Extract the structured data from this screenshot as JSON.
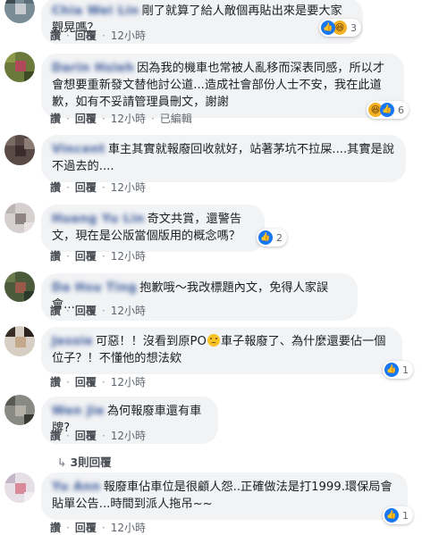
{
  "actions": {
    "like": "讚",
    "reply": "回覆",
    "sep": "·",
    "edited": "已編輯"
  },
  "replies_link": "3則回覆",
  "comments": [
    {
      "name": "Chia Wei Lin",
      "text": "剛了就算了給人敵個再貼出來是要大家觀晃嗎？",
      "time": "12小時",
      "reactions": "3",
      "react_types": [
        "like",
        "haha"
      ]
    },
    {
      "name": "Darin Hsieh",
      "text": "因為我的機車也常被人亂移而深表同感，所以才會想要重新發文替他討公道...造成社會部份人士不安，我在此道歉，如有不妥請管理員刪文，謝謝",
      "time": "12小時",
      "edited": true,
      "reactions": "6",
      "react_types": [
        "haha",
        "like"
      ]
    },
    {
      "name": "Vincent",
      "text": "車主其實就報廢回收就好，站著茅坑不拉屎....其實是說不過去的....",
      "time": "12小時"
    },
    {
      "name": "Huang Yu Lin",
      "text": "奇文共賞，還警告文，現在是公版當個版用的概念嗎？",
      "time": "12小時",
      "reactions": "2",
      "react_types": [
        "like"
      ]
    },
    {
      "name": "Da Hsu Ting",
      "text": "抱歉哦～我改標題內文，免得人家誤會...",
      "time": "12小時"
    },
    {
      "name": "Jessie",
      "text_before": "可惡！！沒看到原PO",
      "text_after": "車子報廢了、為什麼還要佔一個位子？！不懂他的想法欸",
      "time": "12小時",
      "reactions": "1",
      "react_types": [
        "like"
      ]
    },
    {
      "name": "Wen Jie",
      "text": "為何報廢車還有車牌?",
      "time": "12小時"
    },
    {
      "name": "Yu Ann",
      "text": "報廢車佔車位是很顧人怨..正確做法是打1999.環保局會貼單公告...時間到派人拖吊~~",
      "time": "12小時",
      "reactions": "1",
      "react_types": [
        "like"
      ]
    }
  ]
}
